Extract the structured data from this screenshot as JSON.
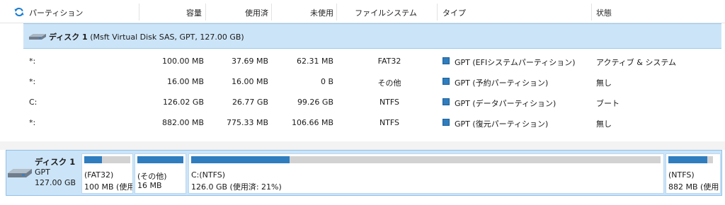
{
  "colors": {
    "accent": "#2f7dbf",
    "selection": "#cce4f7",
    "bar_empty": "#d2d2d2"
  },
  "icons": {
    "refresh": "refresh-icon",
    "disk": "hard-disk-icon",
    "partition_type": "blue-square-icon"
  },
  "columns": {
    "partition": "パーティション",
    "capacity": "容量",
    "used": "使用済",
    "unused": "未使用",
    "filesystem": "ファイルシステム",
    "type": "タイプ",
    "status": "状態"
  },
  "disk": {
    "title": "ディスク 1",
    "detail": "(Msft Virtual Disk SAS, GPT, 127.00 GB)"
  },
  "partitions": [
    {
      "name": "*:",
      "capacity": "100.00 MB",
      "used": "37.69 MB",
      "unused": "62.31 MB",
      "fs": "FAT32",
      "type": "GPT (EFIシステムパーティション)",
      "status": "アクティブ & システム"
    },
    {
      "name": "*:",
      "capacity": "16.00 MB",
      "used": "16.00 MB",
      "unused": "0 B",
      "fs": "その他",
      "type": "GPT (予約パーティション)",
      "status": "無し"
    },
    {
      "name": "C:",
      "capacity": "126.02 GB",
      "used": "26.77 GB",
      "unused": "99.26 GB",
      "fs": "NTFS",
      "type": "GPT (データパーティション)",
      "status": "ブート"
    },
    {
      "name": "*:",
      "capacity": "882.00 MB",
      "used": "775.33 MB",
      "unused": "106.66 MB",
      "fs": "NTFS",
      "type": "GPT (復元パーティション)",
      "status": "無し"
    }
  ],
  "disk_map": {
    "name": "ディスク 1",
    "style": "GPT",
    "size": "127.00 GB",
    "partitions": [
      {
        "label": "(FAT32)",
        "size": "100 MB (使用",
        "usage": 0.38
      },
      {
        "label": "(その他)",
        "size": "16 MB",
        "usage": 1.0
      },
      {
        "label": "C:(NTFS)",
        "size": "126.0 GB (使用済: 21%)",
        "usage": 0.21
      },
      {
        "label": "(NTFS)",
        "size": "882 MB (使用",
        "usage": 0.88
      }
    ]
  }
}
